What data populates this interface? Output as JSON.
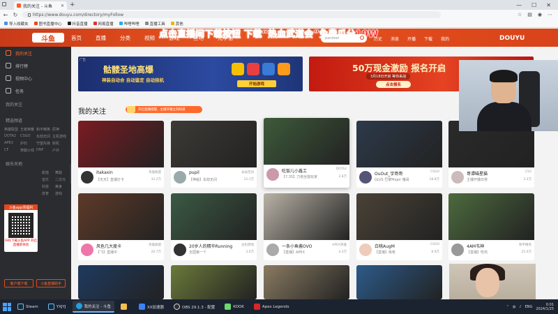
{
  "browser": {
    "tab_title": "我的关注 - 斗鱼",
    "url": "https://www.douyu.com/directory/myFollow",
    "bookmarks": [
      "导入收藏夹",
      "图书直播中心",
      "抖音直播",
      "网易直播",
      "哔哩哔哩",
      "直播工具",
      "其他"
    ]
  },
  "site": {
    "logo": "斗鱼",
    "nav": [
      "首页",
      "直播",
      "分类",
      "视频",
      "游戏",
      "鱼吧",
      "元宇宙"
    ],
    "promo_text": "点击直播间下载按钮 下载“热血武道会”免费瓜分10W",
    "search_placeholder": "pandeel",
    "header_links": [
      "历史",
      "消息",
      "开播",
      "下载",
      "我的"
    ],
    "brand_right": "DOUYU"
  },
  "sidebar": {
    "items": [
      "我的关注",
      "排行榜",
      "视频中心",
      "任务"
    ],
    "section1": "我的关注",
    "section2": "精选频道",
    "grid1": [
      "英雄联盟",
      "王者荣耀",
      "和平精英",
      "原神",
      "DOTA2",
      "CSGO",
      "永劫无间",
      "主机游戏",
      "APEX",
      "炉石",
      "守望先锋",
      "街机",
      "CF",
      "穿越火线",
      "DNF",
      "户外"
    ],
    "section3": "娱乐天地",
    "grid2": [
      "颜值",
      "舞蹈",
      "音乐",
      "二次元",
      "科技",
      "美食",
      "体育",
      "游戏"
    ],
    "qr_top": "斗鱼app领福利",
    "qr_text": "扫码下载斗鱼APP 开启直播新体验",
    "btn_left": "客户端下载",
    "btn_right": "斗鱼直播助手"
  },
  "banners": {
    "b1_tag": "广告",
    "b1_title": "骷髅圣地高爆",
    "b1_sub": "神装自动合 自动鉴定 自动挂机",
    "b1_btn": "开始游戏",
    "b2_title": "50万现金激励 报名开启",
    "b2_sub": "3月18日开启 等你来战",
    "b2_btn": "点击报名"
  },
  "follow": {
    "title": "我的关注",
    "tip": "开启直播提醒，主播开播立刻知道"
  },
  "cards": [
    {
      "name": "itakaxin",
      "cat": "英雄联盟",
      "title": "【天天】直播打卡",
      "views": "32.2万",
      "thumb": "#7a1b22",
      "av": "#333"
    },
    {
      "name": "pupil",
      "cat": "永劫无间",
      "title": "【神秘】永劫无间",
      "views": "12.1万",
      "thumb": "#3d3a36",
      "av": "#9aa"
    },
    {
      "name": "吃饭儿小鑫工",
      "cat": "DOTA2",
      "title": "【7.35】刀塔全能玩家",
      "views": "2.8万",
      "thumb": "#3e5a3a",
      "av": "#c9a"
    },
    {
      "name": "OuOut_宇哥哥",
      "cat": "CSGO",
      "title": "GLVS 巴黎Major 猪哥",
      "views": "18.8万",
      "thumb": "#2d3a4a",
      "av": "#557"
    },
    {
      "name": "哥谭喵星猫",
      "cat": "CS2",
      "title": "主播开播日常",
      "views": "3.2万",
      "thumb": "#2a2a2a",
      "av": "#cbb"
    },
    {
      "name": "风色几大度卡",
      "cat": "英雄联盟",
      "title": "【飞】直播中",
      "views": "26.7万",
      "thumb": "#5e3a28",
      "av": "#e7a"
    },
    {
      "name": "20岁人的精华Running",
      "cat": "主机游戏",
      "title": "全国第一个",
      "views": "3.6万",
      "thumb": "#3b5a44",
      "av": "#333"
    },
    {
      "name": "一条小鱼酱OVO",
      "cat": "APEX英雄",
      "title": "【直播】APEX",
      "views": "4.3万",
      "thumb": "#b9b2a6",
      "av": "#aaa"
    },
    {
      "name": "白桃AugM",
      "cat": "CSGO",
      "title": "【直播】练枪",
      "views": "8.9万",
      "thumb": "#4a4236",
      "av": "#ecb"
    },
    {
      "name": "4AM韦神",
      "cat": "和平精英",
      "title": "【直播】吃鸡",
      "views": "25.4万",
      "thumb": "#4d6a3e",
      "av": "#999"
    }
  ],
  "webcam_note": "",
  "taskbar": {
    "apps": [
      "Steam",
      "YXJYJ",
      "我的关注 - 斗鱼",
      "",
      "XX加速器",
      "OBS 29.1.3 - 配置",
      "KOOK",
      "Apex Legends"
    ],
    "time": "0:01",
    "date": "2024/1/25",
    "lang": "ENG"
  },
  "colors": {
    "accent": "#e8471c",
    "sidebar_bg": "#2b2c30",
    "taskbar_bg": "#1c2330"
  }
}
